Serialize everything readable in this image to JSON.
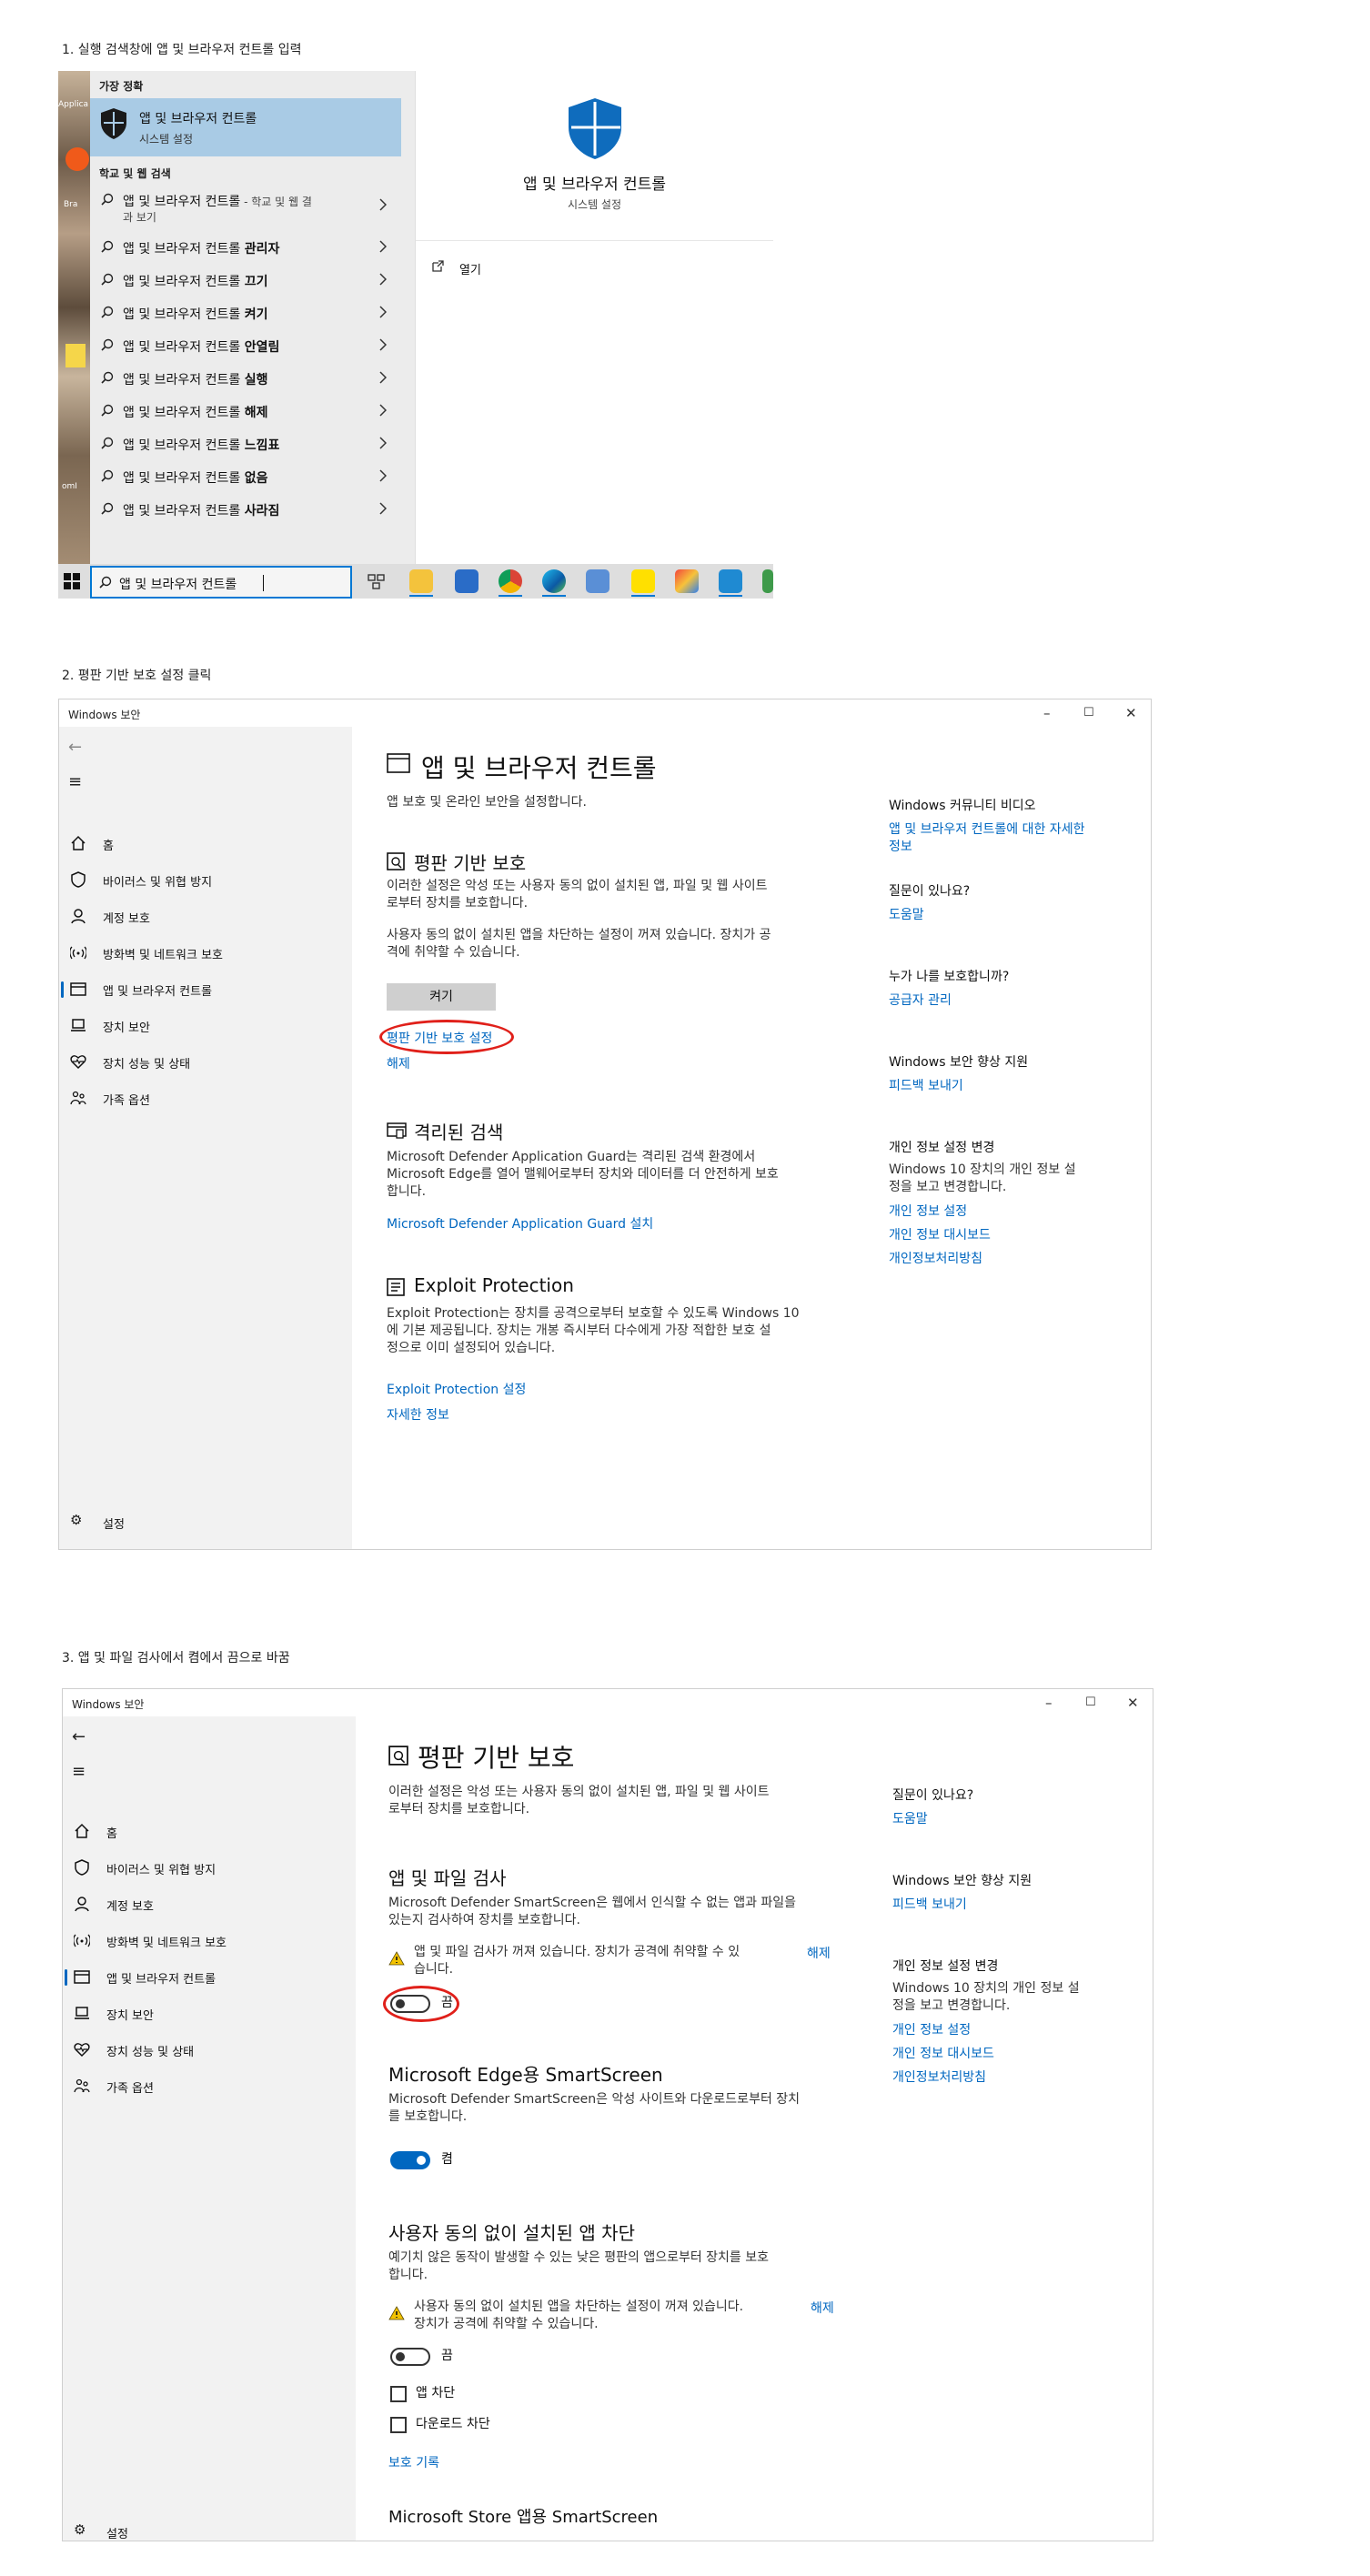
{
  "captions": {
    "step1": "1. 실행 검색창에 앱 및 브라우저 컨트롤 입력",
    "step2": "2. 평판 기반 보호 설정 클릭",
    "step3": "3. 앱 및 파일 검사에서 켬에서 끔으로 바꿈"
  },
  "search": {
    "best_match_header": "가장 정확",
    "best_title": "앱 및 브라우저 컨트롤",
    "best_sub": "시스템 설정",
    "web_header": "학교 및 웹 검색",
    "rows": [
      {
        "base": "앱 및 브라우저 컨트롤",
        "bold": "",
        "extra": " - 학교 및 웹 결",
        "line2": "과 보기"
      },
      {
        "base": "앱 및 브라우저 컨트롤 ",
        "bold": "관리자"
      },
      {
        "base": "앱 및 브라우저 컨트롤 ",
        "bold": "끄기"
      },
      {
        "base": "앱 및 브라우저 컨트롤 ",
        "bold": "켜기"
      },
      {
        "base": "앱 및 브라우저 컨트롤 ",
        "bold": "안열림"
      },
      {
        "base": "앱 및 브라우저 컨트롤 ",
        "bold": "실행"
      },
      {
        "base": "앱 및 브라우저 컨트롤 ",
        "bold": "해제"
      },
      {
        "base": "앱 및 브라우저 컨트롤 ",
        "bold": "느낌표"
      },
      {
        "base": "앱 및 브라우저 컨트롤 ",
        "bold": "없음"
      },
      {
        "base": "앱 및 브라우저 컨트롤 ",
        "bold": "사라짐"
      }
    ],
    "preview_title": "앱 및 브라우저 컨트롤",
    "preview_sub": "시스템 설정",
    "open_label": "열기",
    "query": "앱 및 브라우저 컨트롤",
    "desktop_labels": [
      "Applica",
      "Bra",
      "omI"
    ]
  },
  "window": {
    "title": "Windows 보안",
    "nav": [
      "홈",
      "바이러스 및 위협 방지",
      "계정 보호",
      "방화벽 및 네트워크 보호",
      "앱 및 브라우저 컨트롤",
      "장치 보안",
      "장치 성능 및 상태",
      "가족 옵션"
    ],
    "settings_label": "설정"
  },
  "appctl": {
    "title": "앱 및 브라우저 컨트롤",
    "subtitle": "앱 보호 및 온라인 보안을 설정합니다.",
    "rep_title": "평판 기반 보호",
    "rep_desc": [
      "이러한 설정은 악성 또는 사용자 동의 없이 설치된 앱, 파일 및 웹 사이트",
      "로부터 장치를 보호합니다."
    ],
    "rep_warn": [
      "사용자 동의 없이 설치된 앱을 차단하는 설정이 꺼져 있습니다. 장치가 공",
      "격에 취약할 수 있습니다."
    ],
    "turn_on": "켜기",
    "rep_settings_link": "평판 기반 보호 설정",
    "dismiss": "해제",
    "iso_title": "격리된 검색",
    "iso_desc": [
      "Microsoft Defender Application Guard는 격리된 검색 환경에서",
      "Microsoft Edge를 열어 맬웨어로부터 장치와 데이터를 더 안전하게 보호",
      "합니다."
    ],
    "iso_link": "Microsoft Defender Application Guard 설치",
    "exp_title": "Exploit Protection",
    "exp_desc": [
      "Exploit Protection는 장치를 공격으로부터 보호할 수 있도록 Windows 10",
      "에 기본 제공됩니다. 장치는 개봉 즉시부터 다수에게 가장 적합한 보호 설",
      "정으로 이미 설정되어 있습니다."
    ],
    "exp_link": "Exploit Protection 설정",
    "learn_more": "자세한 정보",
    "right": {
      "community_title": "Windows 커뮤니티 비디오",
      "community_link": [
        "앱 및 브라우저 컨트롤에 대한 자세한",
        "정보"
      ],
      "question_title": "질문이 있나요?",
      "help": "도움말",
      "who_title": "누가 나를 보호합니까?",
      "provider": "공급자 관리",
      "improve_title": "Windows 보안 향상 지원",
      "feedback": "피드백 보내기",
      "privacy_title": "개인 정보 설정 변경",
      "privacy_desc": [
        "Windows 10 장치의 개인 정보 설",
        "정을 보고 변경합니다."
      ],
      "privacy_settings": "개인 정보 설정",
      "privacy_dashboard": "개인 정보 대시보드",
      "privacy_statement": "개인정보처리방침"
    }
  },
  "rep": {
    "title": "평판 기반 보호",
    "desc": [
      "이러한 설정은 악성 또는 사용자 동의 없이 설치된 앱, 파일 및 웹 사이트",
      "로부터 장치를 보호합니다."
    ],
    "appfile_title": "앱 및 파일 검사",
    "appfile_desc": [
      "Microsoft Defender SmartScreen은 웹에서 인식할 수 없는 앱과 파일을",
      "있는지 검사하여 장치를 보호합니다."
    ],
    "appfile_warn": [
      "앱 및 파일 검사가 꺼져 있습니다. 장치가 공격에 취약할 수 있",
      "습니다."
    ],
    "dismiss": "해제",
    "off": "끔",
    "on": "켬",
    "edge_title": "Microsoft Edge용 SmartScreen",
    "edge_desc": [
      "Microsoft Defender SmartScreen은 악성 사이트와 다운로드로부터 장치",
      "를 보호합니다."
    ],
    "pua_title": "사용자 동의 없이 설치된 앱 차단",
    "pua_desc": [
      "예기치 않은 동작이 발생할 수 있는 낮은 평판의 앱으로부터 장치를 보호",
      "합니다."
    ],
    "pua_warn": [
      "사용자 동의 없이 설치된 앱을 차단하는 설정이 꺼져 있습니다.",
      "장치가 공격에 취약할 수 있습니다."
    ],
    "block_apps": "앱 차단",
    "block_downloads": "다운로드 차단",
    "history": "보호 기록",
    "store_title": "Microsoft Store 앱용 SmartScreen",
    "right": {
      "question_title": "질문이 있나요?",
      "help": "도움말",
      "improve_title": "Windows 보안 향상 지원",
      "feedback": "피드백 보내기",
      "privacy_title": "개인 정보 설정 변경",
      "privacy_desc": [
        "Windows 10 장치의 개인 정보 설",
        "정을 보고 변경합니다."
      ],
      "privacy_settings": "개인 정보 설정",
      "privacy_dashboard": "개인 정보 대시보드",
      "privacy_statement": "개인정보처리방침"
    }
  },
  "colors": {
    "accent": "#0067c0",
    "highlight": "#a9cbe5",
    "annotation": "#e0201a",
    "warning": "#f2c200"
  }
}
